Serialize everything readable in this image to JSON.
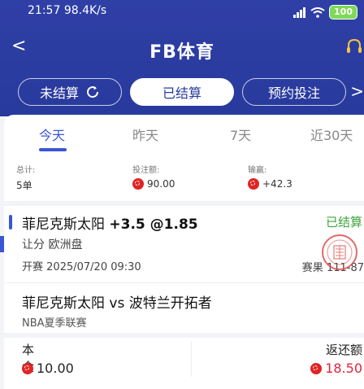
{
  "status_bar": {
    "time": "21:57",
    "speed": "98.4K/s",
    "battery": "100"
  },
  "nav": {
    "title": "FB体育"
  },
  "filters": {
    "items": [
      "未结算",
      "已结算",
      "预约投注"
    ],
    "active_index": 1
  },
  "tabs": {
    "items": [
      "今天",
      "昨天",
      "7天",
      "近30天"
    ],
    "active_index": 0
  },
  "summary": {
    "total_label": "总计:",
    "total_value": "5单",
    "stake_label": "投注额:",
    "stake_value": "90.00",
    "win_label": "输赢:",
    "win_value": "+42.3"
  },
  "bet": {
    "team": "菲尼克斯太阳",
    "odds_text": "+3.5 @1.85",
    "status": "已结算",
    "market": "让分 欧洲盘",
    "start_label": "开赛",
    "start_time": "2025/07/20 09:30",
    "score_label": "赛果",
    "score_value": "111-87"
  },
  "match": {
    "teams": "菲尼克斯太阳 vs 波特兰开拓者",
    "league": "NBA夏季联赛"
  },
  "amounts": {
    "principal_label": "本金",
    "principal_value": "10.00",
    "return_label": "返还额",
    "return_value": "18.50"
  },
  "colors": {
    "header": "#2f3fa6",
    "accent": "#3a56d4",
    "settled": "#3fa53a",
    "win": "#e0243c"
  }
}
